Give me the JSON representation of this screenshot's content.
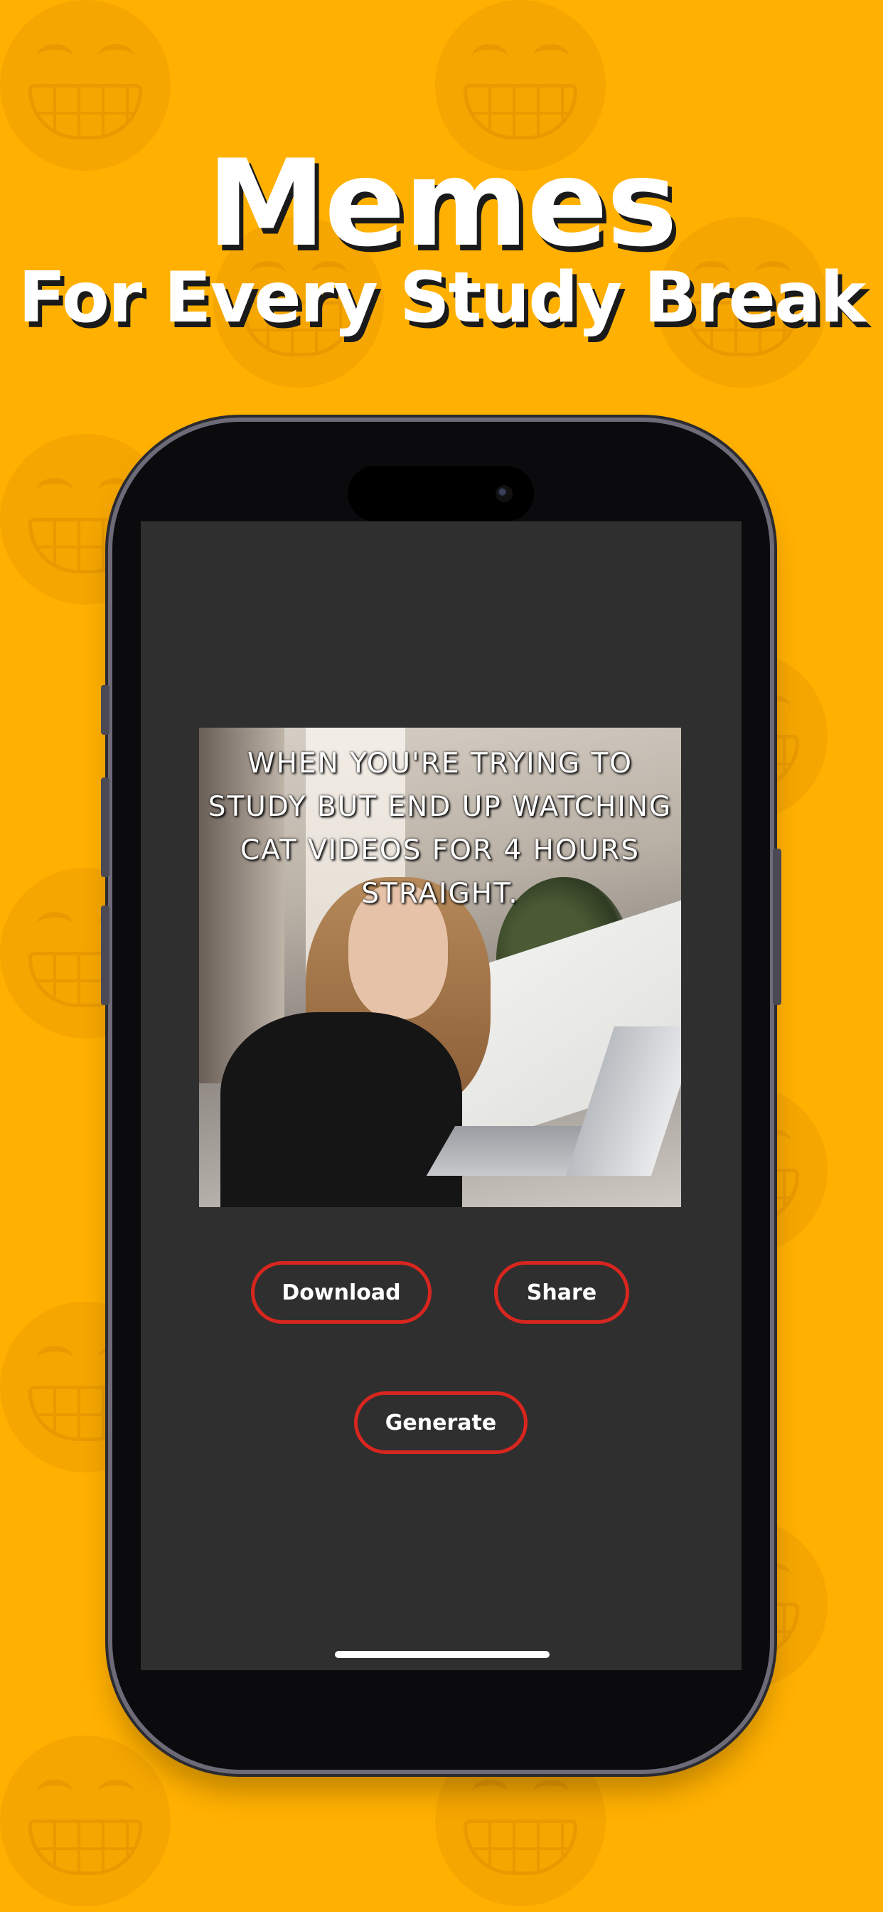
{
  "headline": {
    "title": "Memes",
    "subtitle": "For Every Study Break"
  },
  "background": {
    "color": "#FFB000",
    "pattern_icon": "grinning-face-icon"
  },
  "app": {
    "meme": {
      "caption": "WHEN YOU'RE TRYING TO STUDY BUT END UP WATCHING CAT VIDEOS FOR 4 HOURS STRAIGHT.",
      "image_subject": "woman-at-laptop"
    },
    "buttons": {
      "download_label": "Download",
      "share_label": "Share",
      "generate_label": "Generate"
    },
    "accent_color": "#D8261F",
    "screen_color": "#2F2F2F"
  }
}
